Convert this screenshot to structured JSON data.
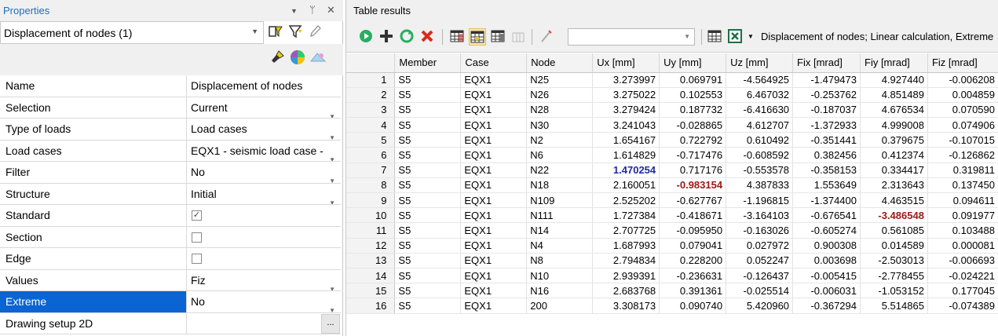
{
  "properties_panel": {
    "title": "Properties",
    "combo_value": "Displacement of nodes (1)",
    "rows": [
      {
        "name": "Name",
        "value": "Displacement of nodes",
        "control": "text"
      },
      {
        "name": "Selection",
        "value": "Current",
        "control": "dropdown"
      },
      {
        "name": "Type of loads",
        "value": "Load cases",
        "control": "dropdown"
      },
      {
        "name": "Load cases",
        "value": "EQX1 - seismic load case -",
        "control": "dropdown"
      },
      {
        "name": "Filter",
        "value": "No",
        "control": "dropdown"
      },
      {
        "name": "Structure",
        "value": "Initial",
        "control": "dropdown"
      },
      {
        "name": "Standard",
        "value": "✓",
        "control": "checkbox"
      },
      {
        "name": "Section",
        "value": "",
        "control": "checkbox"
      },
      {
        "name": "Edge",
        "value": "",
        "control": "checkbox"
      },
      {
        "name": "Values",
        "value": "Fiz",
        "control": "dropdown"
      },
      {
        "name": "Extreme",
        "value": "No",
        "control": "dropdown",
        "selected": true
      },
      {
        "name": "Drawing setup 2D",
        "value": "",
        "control": "ellipsis",
        "button_label": "..."
      }
    ],
    "selection_color": "#0a64d2"
  },
  "table_panel": {
    "title": "Table results",
    "caption": "Displacement of nodes; Linear calculation, Extreme",
    "search_value": "",
    "columns": [
      "Member",
      "Case",
      "Node",
      "Ux [mm]",
      "Uy [mm]",
      "Uz [mm]",
      "Fix [mrad]",
      "Fiy [mrad]",
      "Fiz [mrad]"
    ],
    "rows": [
      {
        "n": "1",
        "cells": [
          "S5",
          "EQX1",
          "N25",
          "3.273997",
          "0.069791",
          "-4.564925",
          "-1.479473",
          "4.927440",
          "-0.006208"
        ]
      },
      {
        "n": "2",
        "cells": [
          "S5",
          "EQX1",
          "N26",
          "3.275022",
          "0.102553",
          "6.467032",
          "-0.253762",
          "4.851489",
          "0.004859"
        ]
      },
      {
        "n": "3",
        "cells": [
          "S5",
          "EQX1",
          "N28",
          "3.279424",
          "0.187732",
          "-6.416630",
          "-0.187037",
          "4.676534",
          "0.070590"
        ]
      },
      {
        "n": "4",
        "cells": [
          "S5",
          "EQX1",
          "N30",
          "3.241043",
          "-0.028865",
          "4.612707",
          "-1.372933",
          "4.999008",
          "0.074906"
        ]
      },
      {
        "n": "5",
        "cells": [
          "S5",
          "EQX1",
          "N2",
          "1.654167",
          "0.722792",
          "0.610492",
          "-0.351441",
          "0.379675",
          "-0.107015"
        ]
      },
      {
        "n": "6",
        "cells": [
          "S5",
          "EQX1",
          "N6",
          "1.614829",
          "-0.717476",
          "-0.608592",
          "0.382456",
          "0.412374",
          "-0.126862"
        ]
      },
      {
        "n": "7",
        "cells": [
          "S5",
          "EQX1",
          "N22",
          "1.470254",
          "0.717176",
          "-0.553578",
          "-0.358153",
          "0.334417",
          "0.319811"
        ],
        "highlight": {
          "3": "max"
        }
      },
      {
        "n": "8",
        "cells": [
          "S5",
          "EQX1",
          "N18",
          "2.160051",
          "-0.983154",
          "4.387833",
          "1.553649",
          "2.313643",
          "0.137450"
        ],
        "highlight": {
          "4": "min"
        }
      },
      {
        "n": "9",
        "cells": [
          "S5",
          "EQX1",
          "N109",
          "2.525202",
          "-0.627767",
          "-1.196815",
          "-1.374400",
          "4.463515",
          "0.094611"
        ]
      },
      {
        "n": "10",
        "cells": [
          "S5",
          "EQX1",
          "N111",
          "1.727384",
          "-0.418671",
          "-3.164103",
          "-0.676541",
          "-3.486548",
          "0.091977"
        ],
        "highlight": {
          "7": "min"
        }
      },
      {
        "n": "11",
        "cells": [
          "S5",
          "EQX1",
          "N14",
          "2.707725",
          "-0.095950",
          "-0.163026",
          "-0.605274",
          "0.561085",
          "0.103488"
        ]
      },
      {
        "n": "12",
        "cells": [
          "S5",
          "EQX1",
          "N4",
          "1.687993",
          "0.079041",
          "0.027972",
          "0.900308",
          "0.014589",
          "0.000081"
        ]
      },
      {
        "n": "13",
        "cells": [
          "S5",
          "EQX1",
          "N8",
          "2.794834",
          "0.228200",
          "0.052247",
          "0.003698",
          "-2.503013",
          "-0.006693"
        ]
      },
      {
        "n": "14",
        "cells": [
          "S5",
          "EQX1",
          "N10",
          "2.939391",
          "-0.236631",
          "-0.126437",
          "-0.005415",
          "-2.778455",
          "-0.024221"
        ]
      },
      {
        "n": "15",
        "cells": [
          "S5",
          "EQX1",
          "N16",
          "2.683768",
          "0.391361",
          "-0.025514",
          "-0.006031",
          "-1.053152",
          "0.177045"
        ]
      },
      {
        "n": "16",
        "cells": [
          "S5",
          "EQX1",
          "200",
          "3.308173",
          "0.090740",
          "5.420960",
          "-0.367294",
          "5.514865",
          "-0.074389"
        ]
      }
    ],
    "max_color": "#1e2b9f",
    "min_color": "#a01818"
  }
}
